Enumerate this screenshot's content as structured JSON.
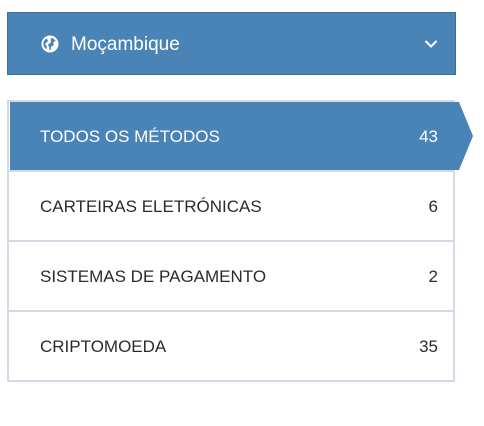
{
  "country_selector": {
    "label": "Moçambique",
    "globe_icon": "globe-icon",
    "chevron_icon": "chevron-down-icon",
    "background": "#4a83b6"
  },
  "methods": {
    "accent": "#4a83b6",
    "items": [
      {
        "label": "TODOS OS MÉTODOS",
        "count": "43",
        "active": true
      },
      {
        "label": "CARTEIRAS ELETRÓNICAS",
        "count": "6",
        "active": false
      },
      {
        "label": "SISTEMAS DE PAGAMENTO",
        "count": "2",
        "active": false
      },
      {
        "label": "CRIPTOMOEDA",
        "count": "35",
        "active": false
      }
    ]
  }
}
